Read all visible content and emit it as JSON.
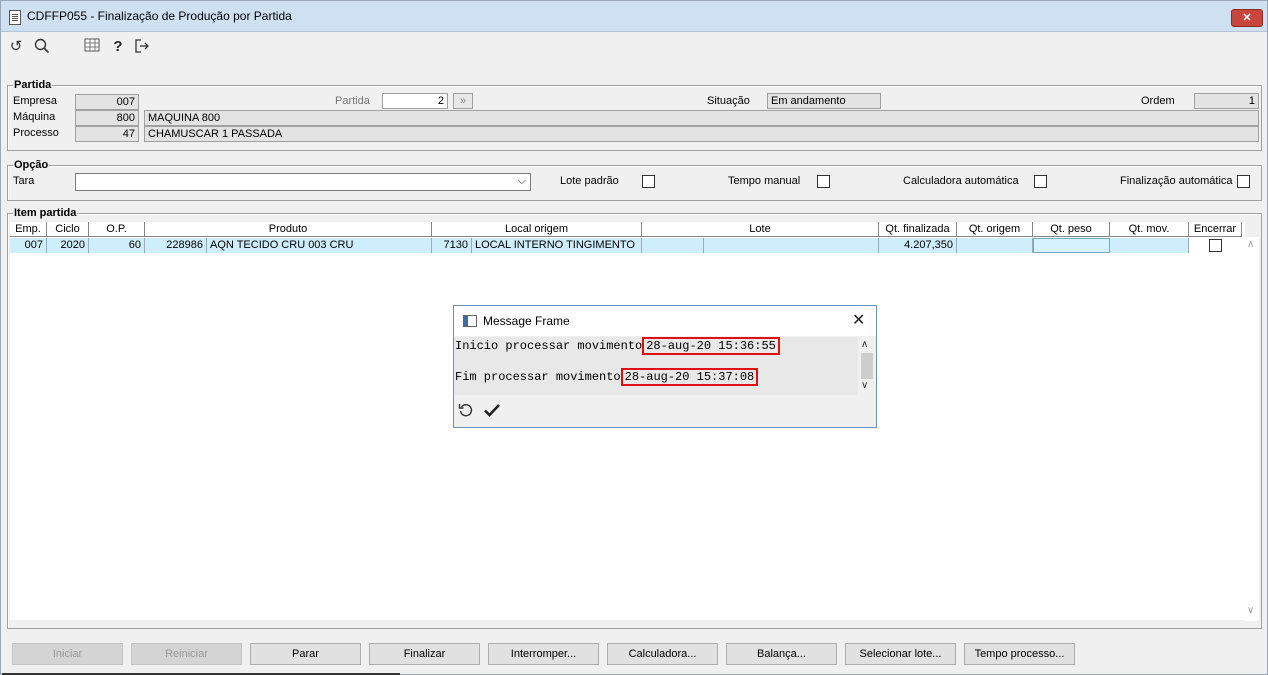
{
  "window": {
    "title": "CDFFP055 - Finalização de Produção por Partida",
    "close_label": "✕"
  },
  "toolbar": {
    "icons": [
      "refresh-icon",
      "search-icon",
      "grid-icon",
      "help-icon",
      "exit-icon"
    ]
  },
  "partida": {
    "group_label": "Partida",
    "empresa_label": "Empresa",
    "empresa_value": "007",
    "partida_label": "Partida",
    "partida_value": "2",
    "situacao_label": "Situação",
    "situacao_value": "Em andamento",
    "ordem_label": "Ordem",
    "ordem_value": "1",
    "maquina_label": "Máquina",
    "maquina_code": "800",
    "maquina_desc": "MAQUINA 800",
    "processo_label": "Processo",
    "processo_code": "47",
    "processo_desc": "CHAMUSCAR 1 PASSADA"
  },
  "opcao": {
    "group_label": "Opção",
    "tara_label": "Tara",
    "tara_value": "",
    "lote_padrao_label": "Lote padrão",
    "lote_padrao_checked": false,
    "tempo_manual_label": "Tempo manual",
    "tempo_manual_checked": false,
    "calculadora_label": "Calculadora automática",
    "calculadora_checked": false,
    "finalizacao_label": "Finalização automática",
    "finalizacao_checked": false
  },
  "item_partida": {
    "group_label": "Item partida",
    "columns": [
      "Emp.",
      "Ciclo",
      "O.P.",
      "Produto",
      "Local origem",
      "Lote",
      "Qt. finalizada",
      "Qt. origem",
      "Qt. peso",
      "Qt. mov.",
      "Encerrar"
    ],
    "rows": [
      {
        "emp": "007",
        "ciclo": "2020",
        "op": "60",
        "produto_code": "228986",
        "produto_desc": "AQN TECIDO CRU 003 CRU",
        "local_code": "7130",
        "local_desc": "LOCAL INTERNO TINGIMENTO",
        "lote_a": "",
        "lote_b": "",
        "qt_finalizada": "4.207,350",
        "qt_origem": "",
        "qt_peso": "",
        "qt_mov": "",
        "encerrar": false
      }
    ]
  },
  "dialog": {
    "title": "Message Frame",
    "line1_label": "Inicio processar movimento",
    "line1_time": "28-aug-20 15:36:55",
    "line2_label": "Fim processar movimento",
    "line2_time": "28-aug-20 15:37:08",
    "highlight_color": "#e01010"
  },
  "buttons": {
    "iniciar": "Iniciar",
    "reiniciar": "Reiniciar",
    "parar": "Parar",
    "finalizar": "Finalizar",
    "interromper": "Interromper...",
    "calculadora": "Calculadora...",
    "balanca": "Balança...",
    "selecionar_lote": "Selecionar lote...",
    "tempo_processo": "Tempo processo..."
  },
  "colors": {
    "titlebar": "#cfe0f3",
    "selected_row": "#cfeefc",
    "window_bg": "#f0f0f0"
  }
}
